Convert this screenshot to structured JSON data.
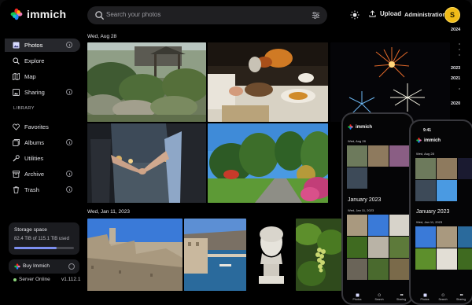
{
  "app": {
    "name": "immich"
  },
  "header": {
    "search_placeholder": "Search your photos",
    "upload_label": "Upload",
    "admin_label": "Administration",
    "avatar_initial": "S"
  },
  "sidebar": {
    "items": [
      {
        "label": "Photos",
        "icon": "photos-icon",
        "active": true
      },
      {
        "label": "Explore",
        "icon": "explore-icon"
      },
      {
        "label": "Map",
        "icon": "map-icon"
      },
      {
        "label": "Sharing",
        "icon": "sharing-icon"
      }
    ],
    "library_label": "LIBRARY",
    "library_items": [
      {
        "label": "Favorites",
        "icon": "heart-icon"
      },
      {
        "label": "Albums",
        "icon": "albums-icon"
      },
      {
        "label": "Utilities",
        "icon": "utilities-icon"
      },
      {
        "label": "Archive",
        "icon": "archive-icon"
      },
      {
        "label": "Trash",
        "icon": "trash-icon"
      }
    ],
    "storage": {
      "title": "Storage space",
      "usage": "82.4 TiB of 115.1 TiB used",
      "fraction_used": 0.716
    },
    "buy_label": "Buy Immich",
    "server_status": "Server Online",
    "version": "v1.112.1"
  },
  "timeline": {
    "groups": [
      {
        "date": "Wed, Aug 28"
      },
      {
        "date": "Wed, Jan 11, 2023"
      }
    ],
    "years": [
      "2024",
      "2023",
      "2021",
      "2020"
    ]
  },
  "phone_left": {
    "logo": "immich",
    "date1": "Wed, Aug 28",
    "month": "January 2023",
    "date2": "Wed, Jan 11, 2023",
    "tabs": [
      "Photos",
      "Search",
      "Sharing"
    ]
  },
  "phone_right": {
    "time": "9:41",
    "logo": "immich",
    "date1": "Wed, Aug 28",
    "month": "January 2023",
    "date2": "Wed, Jan 11, 2023",
    "tabs": [
      "Photos",
      "Search",
      "Sharing"
    ]
  },
  "colors": {
    "background": "#000000",
    "accent": "#7d8ff0",
    "avatar": "#f0bb18",
    "online": "#8bd47b"
  }
}
